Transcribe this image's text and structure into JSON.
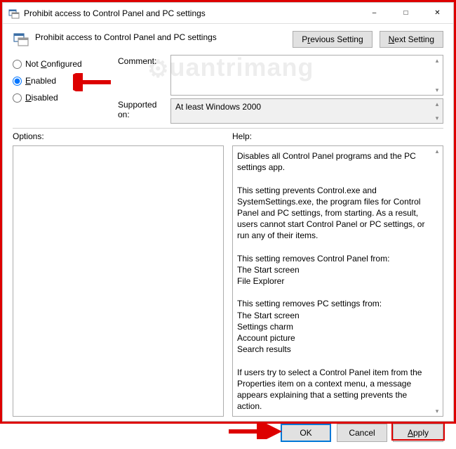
{
  "window": {
    "title": "Prohibit access to Control Panel and PC settings"
  },
  "header": {
    "title": "Prohibit access to Control Panel and PC settings",
    "prev_label_pre": "P",
    "prev_label_ul": "r",
    "prev_label_post": "evious Setting",
    "next_label_pre": "",
    "next_label_ul": "N",
    "next_label_post": "ext Setting"
  },
  "radios": {
    "not_configured_pre": "Not ",
    "not_configured_ul": "C",
    "not_configured_post": "onfigured",
    "enabled_ul": "E",
    "enabled_post": "nabled",
    "disabled_ul": "D",
    "disabled_post": "isabled"
  },
  "labels": {
    "comment": "Comment:",
    "supported_on": "Supported on:",
    "options": "Options:",
    "help": "Help:"
  },
  "supported_text": "At least Windows 2000",
  "comment_text": "",
  "help_text": "Disables all Control Panel programs and the PC settings app.\n\nThis setting prevents Control.exe and SystemSettings.exe, the program files for Control Panel and PC settings, from starting. As a result, users cannot start Control Panel or PC settings, or run any of their items.\n\nThis setting removes Control Panel from:\nThe Start screen\nFile Explorer\n\nThis setting removes PC settings from:\nThe Start screen\nSettings charm\nAccount picture\nSearch results\n\nIf users try to select a Control Panel item from the Properties item on a context menu, a message appears explaining that a setting prevents the action.",
  "footer": {
    "ok": "OK",
    "cancel": "Cancel",
    "apply_ul": "A",
    "apply_post": "pply"
  },
  "watermark": "uantrimang"
}
